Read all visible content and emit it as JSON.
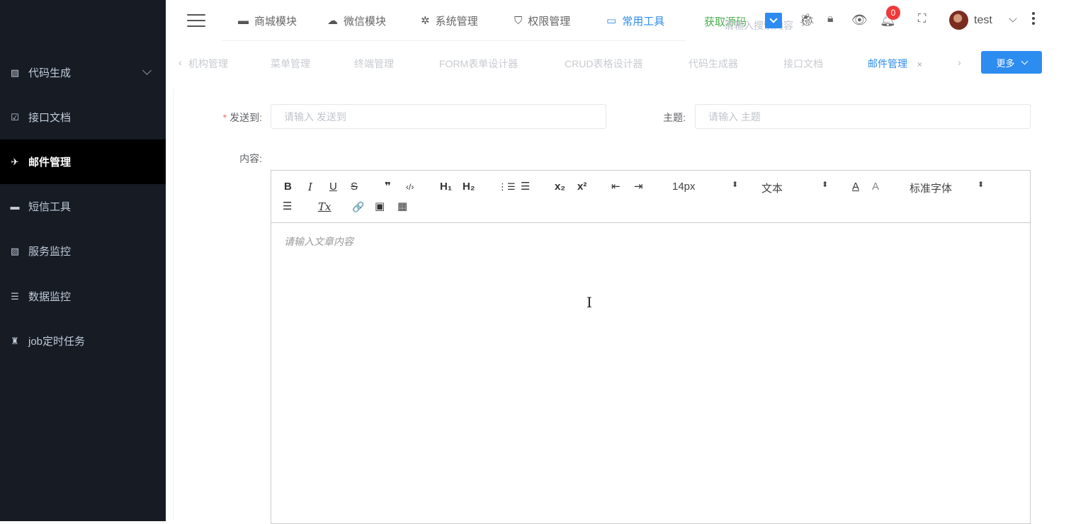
{
  "sidebar": {
    "items": [
      {
        "label": "代码生成",
        "icon": "chart-line-icon",
        "glyph": "▨",
        "has_chevron": true,
        "active": false
      },
      {
        "label": "接口文档",
        "icon": "clipboard-check-icon",
        "glyph": "☑",
        "active": false
      },
      {
        "label": "邮件管理",
        "icon": "paper-plane-icon",
        "glyph": "✈",
        "active": true
      },
      {
        "label": "短信工具",
        "icon": "message-icon",
        "glyph": "▬",
        "active": false
      },
      {
        "label": "服务监控",
        "icon": "chart-line-icon",
        "glyph": "▨",
        "active": false
      },
      {
        "label": "数据监控",
        "icon": "sliders-icon",
        "glyph": "☰",
        "active": false
      },
      {
        "label": "job定时任务",
        "icon": "robot-icon",
        "glyph": "♜",
        "active": false
      }
    ]
  },
  "topbar": {
    "menus": [
      {
        "label": "商城模块",
        "icon": "shop-icon",
        "glyph": "▬"
      },
      {
        "label": "微信模块",
        "icon": "wechat-icon",
        "glyph": "☁"
      },
      {
        "label": "系统管理",
        "icon": "gear-icon",
        "glyph": "✲"
      },
      {
        "label": "权限管理",
        "icon": "shield-icon",
        "glyph": "⛉"
      },
      {
        "label": "常用工具",
        "icon": "toolbox-icon",
        "glyph": "▭",
        "active": true
      }
    ],
    "get_source_label": "获取源码",
    "search_placeholder": "请输入搜索内容",
    "notification_count": "0",
    "username": "test",
    "icons": [
      "bug-icon",
      "lock-icon",
      "eye-icon",
      "bell-icon",
      "fullscreen-icon"
    ]
  },
  "tabs": {
    "items": [
      {
        "label": "机构管理",
        "active": false
      },
      {
        "label": "菜单管理",
        "active": false
      },
      {
        "label": "终端管理",
        "active": false
      },
      {
        "label": "FORM表单设计器",
        "active": false
      },
      {
        "label": "CRUD表格设计器",
        "active": false
      },
      {
        "label": "代码生成器",
        "active": false
      },
      {
        "label": "接口文档",
        "active": false
      },
      {
        "label": "邮件管理",
        "active": true
      }
    ],
    "close_glyph": "×",
    "prev_glyph": "‹",
    "next_glyph": "›",
    "more_label": "更多"
  },
  "form": {
    "to_label": "发送到:",
    "to_required_mark": "*",
    "to_placeholder": "请输入 发送到",
    "subject_label": "主题:",
    "subject_placeholder": "请输入 主题",
    "content_label": "内容:"
  },
  "editor": {
    "toolbar": {
      "bold": "B",
      "italic": "I",
      "underline": "U",
      "strike": "S",
      "quote": "❞",
      "code": "‹/›",
      "h1": "H₁",
      "h2": "H₂",
      "ordered_list": "⋮☰",
      "bullet_list": "☰",
      "subscript": "x₂",
      "superscript": "x²",
      "outdent": "⇤",
      "indent": "⇥",
      "size": "14px",
      "header": "文本",
      "font": "标准字体",
      "color": "A",
      "background": "A",
      "align": "☰",
      "clean": "Tx",
      "link": "🔗",
      "image": "▣",
      "video": "▦",
      "select_arrow": "⬍"
    },
    "placeholder": "请输入文章内容"
  }
}
